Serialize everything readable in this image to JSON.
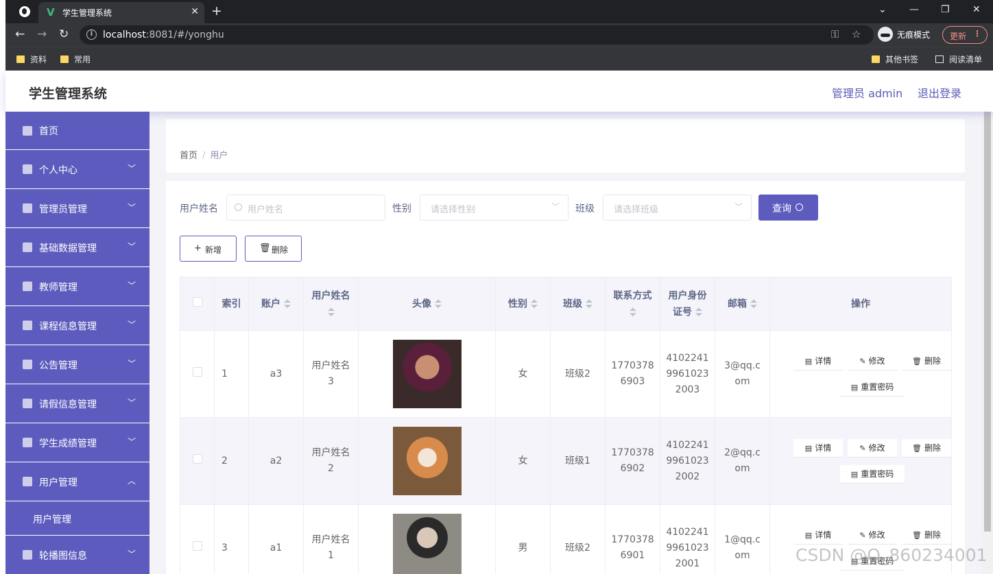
{
  "browser": {
    "tab_title": "学生管理系统",
    "tab_favicon": "vue-logo-icon",
    "url_host": "localhost",
    "url_rest": ":8081/#/yonghu",
    "incognito_label": "无痕模式",
    "update_label": "更新",
    "bookmarks": [
      "资料",
      "常用"
    ],
    "bookmarks_right": [
      "其他书签",
      "阅读清单"
    ]
  },
  "header": {
    "title": "学生管理系统",
    "user": "管理员 admin",
    "logout": "退出登录"
  },
  "sidebar": {
    "items": [
      {
        "label": "首页",
        "icon": "home-icon",
        "arrow": ""
      },
      {
        "label": "个人中心",
        "icon": "user-icon",
        "arrow": "﹀"
      },
      {
        "label": "管理员管理",
        "icon": "clipboard-icon",
        "arrow": "﹀"
      },
      {
        "label": "基础数据管理",
        "icon": "brush-icon",
        "arrow": "﹀"
      },
      {
        "label": "教师管理",
        "icon": "chat-icon",
        "arrow": "﹀"
      },
      {
        "label": "课程信息管理",
        "icon": "card-icon",
        "arrow": "﹀"
      },
      {
        "label": "公告管理",
        "icon": "grid-icon",
        "arrow": "﹀"
      },
      {
        "label": "请假信息管理",
        "icon": "compass-icon",
        "arrow": "﹀"
      },
      {
        "label": "学生成绩管理",
        "icon": "chart-icon",
        "arrow": "﹀"
      },
      {
        "label": "用户管理",
        "icon": "scan-icon",
        "arrow": "︿"
      }
    ],
    "submenu": "用户管理",
    "last_item": {
      "label": "轮播图信息",
      "icon": "copy-icon",
      "arrow": "﹀"
    }
  },
  "breadcrumb": {
    "home": "首页",
    "sep": "/",
    "current": "用户"
  },
  "filters": {
    "name_label": "用户姓名",
    "name_placeholder": "用户姓名",
    "gender_label": "性别",
    "gender_placeholder": "请选择性别",
    "class_label": "班级",
    "class_placeholder": "请选择班级",
    "search_button": "查询"
  },
  "actions": {
    "add": "新增",
    "delete": "删除"
  },
  "table": {
    "headers": {
      "index": "索引",
      "account": "账户",
      "name_1": "用户姓名",
      "avatar": "头像",
      "gender": "性别",
      "class": "班级",
      "phone_1": "联系方式",
      "id_1": "用户身份",
      "id_2": "证号",
      "email": "邮箱",
      "ops": "操作"
    },
    "rows": [
      {
        "index": "1",
        "account": "a3",
        "name_a": "用户姓名",
        "name_b": "3",
        "gender": "女",
        "class": "班级2",
        "phone_a": "1770378",
        "phone_b": "6903",
        "id_a": "4102241",
        "id_b": "9961023",
        "id_c": "2003",
        "email_a": "3@qq.c",
        "email_b": "om"
      },
      {
        "index": "2",
        "account": "a2",
        "name_a": "用户姓名",
        "name_b": "2",
        "gender": "女",
        "class": "班级1",
        "phone_a": "1770378",
        "phone_b": "6902",
        "id_a": "4102241",
        "id_b": "9961023",
        "id_c": "2002",
        "email_a": "2@qq.c",
        "email_b": "om"
      },
      {
        "index": "3",
        "account": "a1",
        "name_a": "用户姓名",
        "name_b": "1",
        "gender": "男",
        "class": "班级2",
        "phone_a": "1770378",
        "phone_b": "6901",
        "id_a": "4102241",
        "id_b": "9961023",
        "id_c": "2001",
        "email_a": "1@qq.c",
        "email_b": "om"
      }
    ],
    "op_labels": {
      "detail": "详情",
      "edit": "修改",
      "delete": "删除",
      "reset": "重置密码"
    }
  },
  "watermark": "CSDN @Q_860234001"
}
